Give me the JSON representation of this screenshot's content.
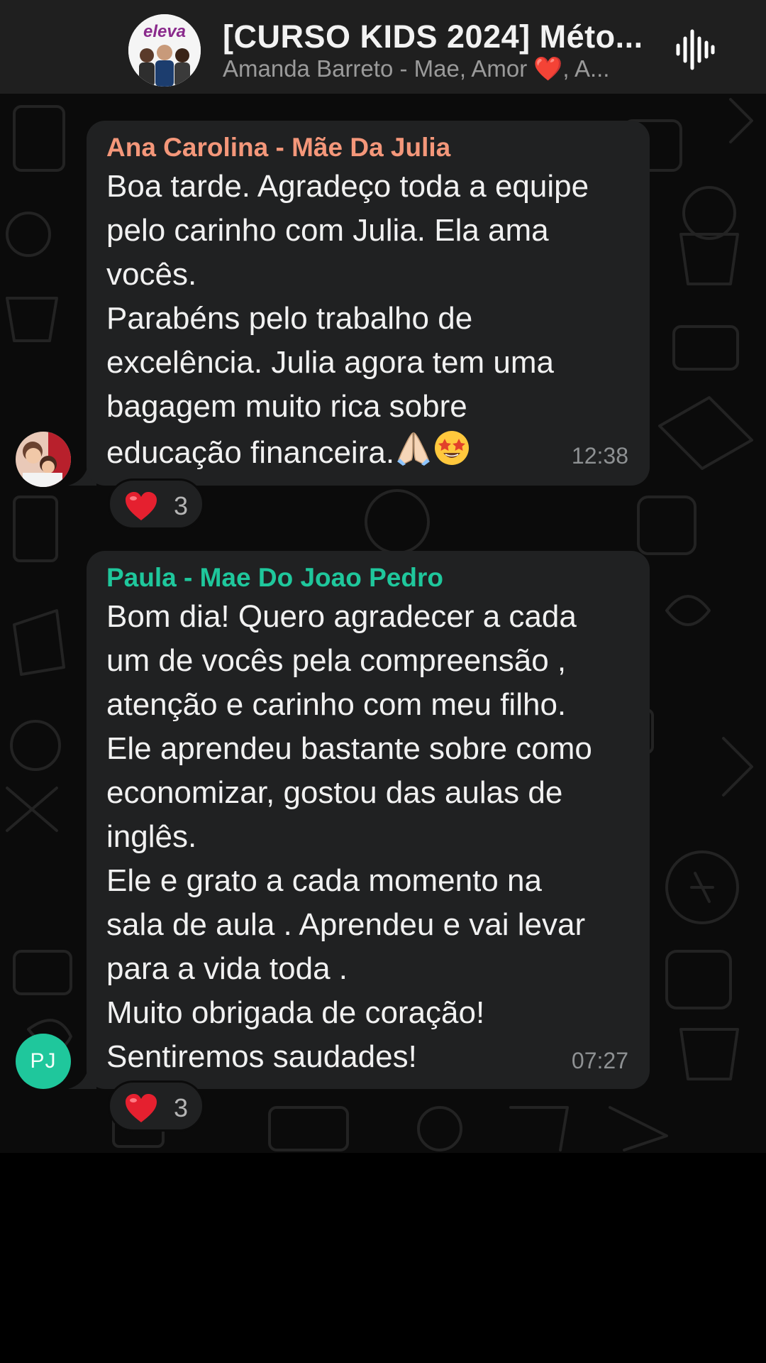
{
  "header": {
    "title": "[CURSO KIDS 2024] Méto...",
    "subtitle": "Amanda Barreto - Mae, Amor ❤️, A...",
    "avatar_logo_text": "eleva"
  },
  "messages": [
    {
      "sender": "Ana Carolina - Mãe Da Julia",
      "sender_color": "#f4977a",
      "lines": [
        "Boa tarde. Agradeço toda a equipe",
        "pelo carinho com Julia. Ela ama",
        "vocês.",
        "Parabéns pelo trabalho de",
        "excelência. Julia agora tem uma",
        "bagagem muito rica sobre",
        "educação financeira."
      ],
      "trailing_emojis": [
        "praying-hands",
        "star-struck"
      ],
      "time": "12:38",
      "reaction": {
        "emoji": "❤️",
        "count": "3"
      }
    },
    {
      "sender": "Paula - Mae Do Joao Pedro",
      "sender_color": "#1fc79c",
      "avatar_initials": "PJ",
      "lines": [
        "Bom dia!  Quero agradecer a cada",
        "um de vocês pela compreensão ,",
        "atenção e carinho com meu filho.",
        "Ele aprendeu bastante sobre como",
        "economizar, gostou das aulas de",
        "inglês.",
        "Ele e grato a cada momento na",
        "sala de aula . Aprendeu e vai levar",
        "para a vida toda .",
        "Muito obrigada de coração!",
        "Sentiremos saudades!"
      ],
      "time": "07:27",
      "reaction": {
        "emoji": "❤️",
        "count": "3"
      }
    }
  ],
  "colors": {
    "header_bg": "#1f1f1f",
    "chat_bg": "#0b0b0b",
    "bubble_bg": "#202122",
    "message_text": "#f1f1f1",
    "time_text": "#8e9193"
  }
}
